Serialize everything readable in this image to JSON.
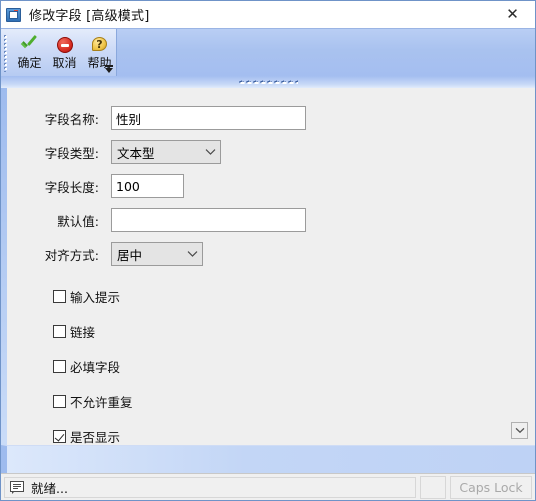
{
  "window": {
    "title": "修改字段 [高级模式]",
    "icon": "window-blue-icon",
    "close_label": "✕"
  },
  "toolbar": {
    "buttons": [
      {
        "label": "确定",
        "icon": "green-check-icon"
      },
      {
        "label": "取消",
        "icon": "red-stop-icon"
      },
      {
        "label": "帮助",
        "icon": "yellow-help-balloon-icon"
      }
    ],
    "overflow_icon": "toolbar-overflow-chevron-icon"
  },
  "form": {
    "fields": [
      {
        "label": "字段名称:",
        "kind": "text",
        "value": "性别",
        "placeholder": "",
        "width": "wide",
        "name": "field-name"
      },
      {
        "label": "字段类型:",
        "kind": "combo",
        "value": "文本型",
        "width": "combo1",
        "name": "field-type",
        "options": [
          "文本型"
        ]
      },
      {
        "label": "字段长度:",
        "kind": "text",
        "value": "100",
        "placeholder": "",
        "width": "small",
        "name": "field-length"
      },
      {
        "label": "默认值:",
        "kind": "text",
        "value": "",
        "placeholder": "",
        "width": "wide",
        "name": "field-default"
      },
      {
        "label": "对齐方式:",
        "kind": "combo",
        "value": "居中",
        "width": "combo2",
        "name": "field-align",
        "options": [
          "居中"
        ]
      }
    ],
    "checkboxes": [
      {
        "label": "输入提示",
        "checked": false,
        "name": "input-hint"
      },
      {
        "label": "链接",
        "checked": false,
        "name": "link"
      },
      {
        "label": "必填字段",
        "checked": false,
        "name": "required-field"
      },
      {
        "label": "不允许重复",
        "checked": false,
        "name": "no-duplicate"
      },
      {
        "label": "是否显示",
        "checked": true,
        "name": "visible"
      }
    ],
    "scroll_down_icon": "chevron-down-icon"
  },
  "statusbar": {
    "icon": "message-bubble-icon",
    "message": "就绪...",
    "caps_lock": "Caps Lock"
  },
  "colors": {
    "titlebar_bg": "#ffffff",
    "toolbar_bg": "#a9c2ef",
    "toolbar_band": "#cfdcf7",
    "form_bg": "#efefef",
    "frame_border": "#6f93c8",
    "accent_blue": "#9ebbee",
    "status_bg": "#f0f0f0",
    "disabled_text": "#a9a9a9"
  }
}
